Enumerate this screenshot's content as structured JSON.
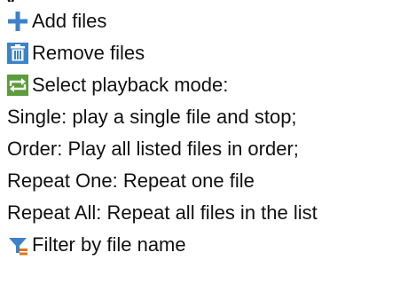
{
  "colors": {
    "icon_blue": "#3d82c9",
    "icon_green": "#5c9c3c",
    "icon_orange": "#e3741a",
    "text": "#111111"
  },
  "header_fragment": "y",
  "items": [
    {
      "icon": "plus-icon",
      "text": "Add files"
    },
    {
      "icon": "trash-icon",
      "text": "Remove files"
    },
    {
      "icon": "repeat-icon",
      "text": "Select playback mode:"
    },
    {
      "text": "Single: play a single file and stop;"
    },
    {
      "text": "Order: Play all listed files in order;"
    },
    {
      "text": "Repeat One: Repeat one file"
    },
    {
      "text": "Repeat All: Repeat all files in the list"
    },
    {
      "icon": "filter-icon",
      "text": "Filter by file name"
    }
  ]
}
